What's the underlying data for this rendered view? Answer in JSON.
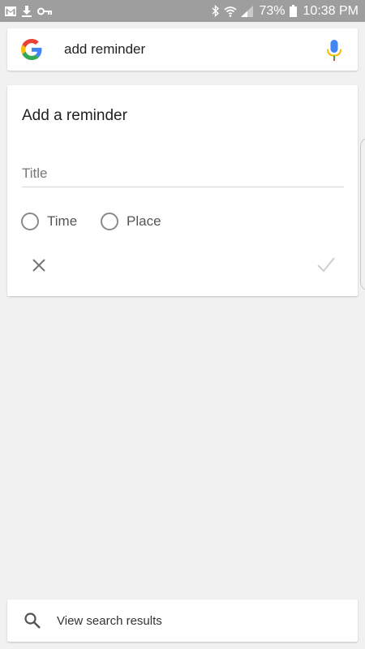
{
  "status_bar": {
    "battery": "73%",
    "time": "10:38 PM",
    "icons": [
      "gmail-icon",
      "download-icon",
      "key-icon",
      "bluetooth-icon",
      "wifi-icon",
      "signal-icon",
      "battery-icon"
    ]
  },
  "search": {
    "query": "add reminder",
    "logo": "google-g-icon",
    "voice_icon": "mic-icon"
  },
  "reminder_card": {
    "heading": "Add a reminder",
    "title_placeholder": "Title",
    "options": [
      "Time",
      "Place"
    ],
    "cancel_icon": "close-icon",
    "confirm_icon": "check-icon"
  },
  "bottom_bar": {
    "label": "View search results",
    "icon": "search-icon"
  },
  "colors": {
    "status_bar": "#9e9e9e",
    "background": "#f1f1f1",
    "google_blue": "#4285F4",
    "google_red": "#EA4335",
    "google_yellow": "#FBBC05",
    "google_green": "#34A853"
  }
}
